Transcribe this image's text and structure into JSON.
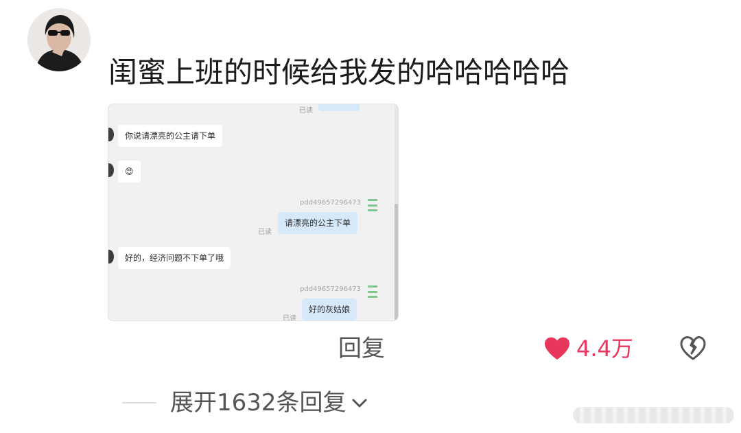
{
  "comment": {
    "text": "闺蜜上班的时候给我发的哈哈哈哈哈"
  },
  "chat_screenshot": {
    "top_read": "已读",
    "messages": [
      {
        "side": "left",
        "text": "你说请漂亮的公主请下单"
      },
      {
        "side": "left",
        "text": "😍"
      },
      {
        "side": "right",
        "sender": "pdd49657296473",
        "read": "已读",
        "text": "请漂亮的公主下单"
      },
      {
        "side": "left",
        "text": "好的，经济问题不下单了哦"
      },
      {
        "side": "right",
        "sender": "pdd49657296473",
        "read": "已读",
        "text": "好的灰姑娘"
      }
    ]
  },
  "actions": {
    "reply_label": "回复",
    "like_count": "4.4万",
    "like_color": "#e8365d"
  },
  "replies": {
    "expand_label": "展开1632条回复"
  },
  "icons": {
    "like": "heart-icon",
    "dislike": "broken-heart-icon",
    "expand": "chevron-down-icon"
  }
}
